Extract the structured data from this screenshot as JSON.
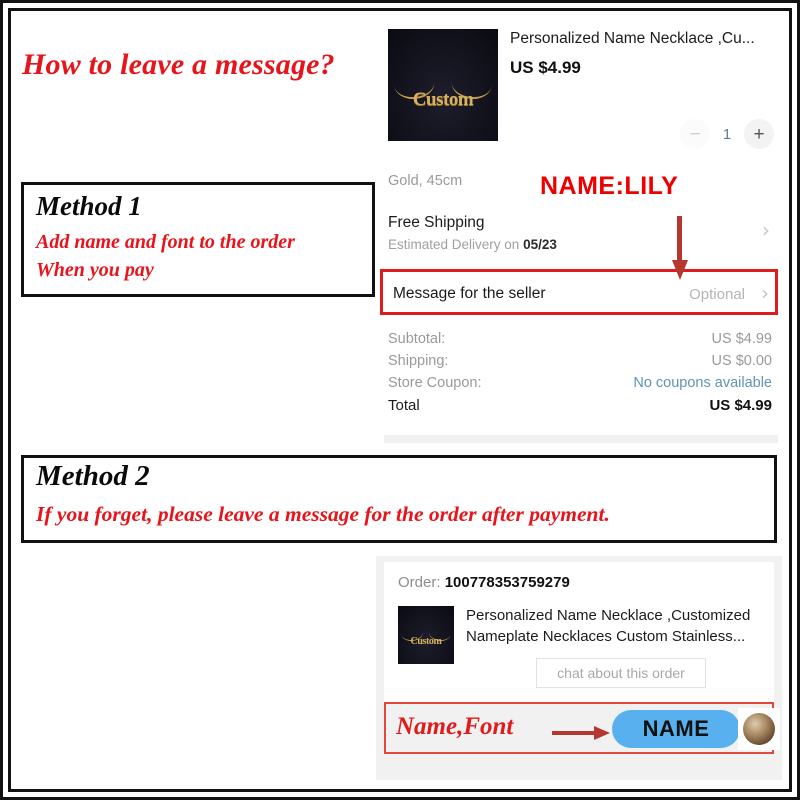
{
  "title": "How to leave a message?",
  "method1": {
    "heading": "Method 1",
    "line1": "Add name and font to the order",
    "line2": "When you pay"
  },
  "method2": {
    "heading": "Method 2",
    "line1": "If you forget, please leave a message for the order after payment."
  },
  "checkout": {
    "product": {
      "title": "Personalized Name Necklace ,Cu...",
      "price": "US $4.99",
      "variant": "Gold, 45cm",
      "thumb_text": "Custom"
    },
    "quantity": {
      "minus": "−",
      "value": "1",
      "plus": "+"
    },
    "shipping": {
      "title": "Free Shipping",
      "estimate_prefix": "Estimated Delivery on ",
      "estimate_date": "05/23",
      "chevron": "›"
    },
    "message_row": {
      "label": "Message for the seller",
      "optional": "Optional",
      "chevron": "›"
    },
    "summary": [
      {
        "key": "Subtotal:",
        "value": "US $4.99"
      },
      {
        "key": "Shipping:",
        "value": "US $0.00"
      },
      {
        "key": "Store Coupon:",
        "value": "No coupons available"
      },
      {
        "key": "Total",
        "value": "US $4.99"
      }
    ]
  },
  "annotations": {
    "name_lily": "NAME:LILY",
    "name_font": "Name,Font",
    "bubble_text": "NAME"
  },
  "order": {
    "label": "Order: ",
    "number": "100778353759279",
    "product_title": "Personalized Name Necklace ,Customized Nameplate Necklaces Custom Stainless...",
    "thumb_text": "Custom",
    "chat_button": "chat about this order"
  },
  "colors": {
    "red": "#e8141b",
    "bright_red": "#ee0000",
    "arrow_red": "#b5372f",
    "bubble_blue": "#58b0ef",
    "coupon_link": "#5f93b5"
  }
}
